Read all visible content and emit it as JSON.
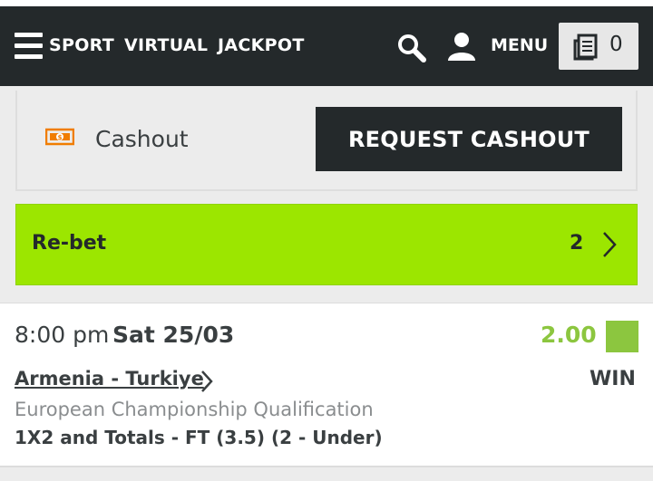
{
  "nav": {
    "sport": "SPORT",
    "virtual": "VIRTUAL",
    "jackpot": "JACKPOT",
    "menu": "MENU",
    "betslip_count": "0",
    "icons": [
      "hamburger-icon",
      "search-icon",
      "user-icon",
      "betslip-icon"
    ]
  },
  "cashout": {
    "label": "Cashout",
    "button": "REQUEST CASHOUT",
    "icon": "cashout-icon"
  },
  "rebet": {
    "label": "Re-bet",
    "count": "2"
  },
  "bet": {
    "time": "8:00 pm",
    "date": "Sat 25/03",
    "odds": "2.00",
    "match": "Armenia - Turkiye",
    "result": "WIN",
    "competition": "European Championship Qualification",
    "market": "1X2 and Totals - FT (3.5) (2 - Under)"
  },
  "colors": {
    "nav_bg": "#24292b",
    "rebet_bg": "#9ce600",
    "win_green": "#8cc63f",
    "cashout_orange": "#f07d00"
  }
}
